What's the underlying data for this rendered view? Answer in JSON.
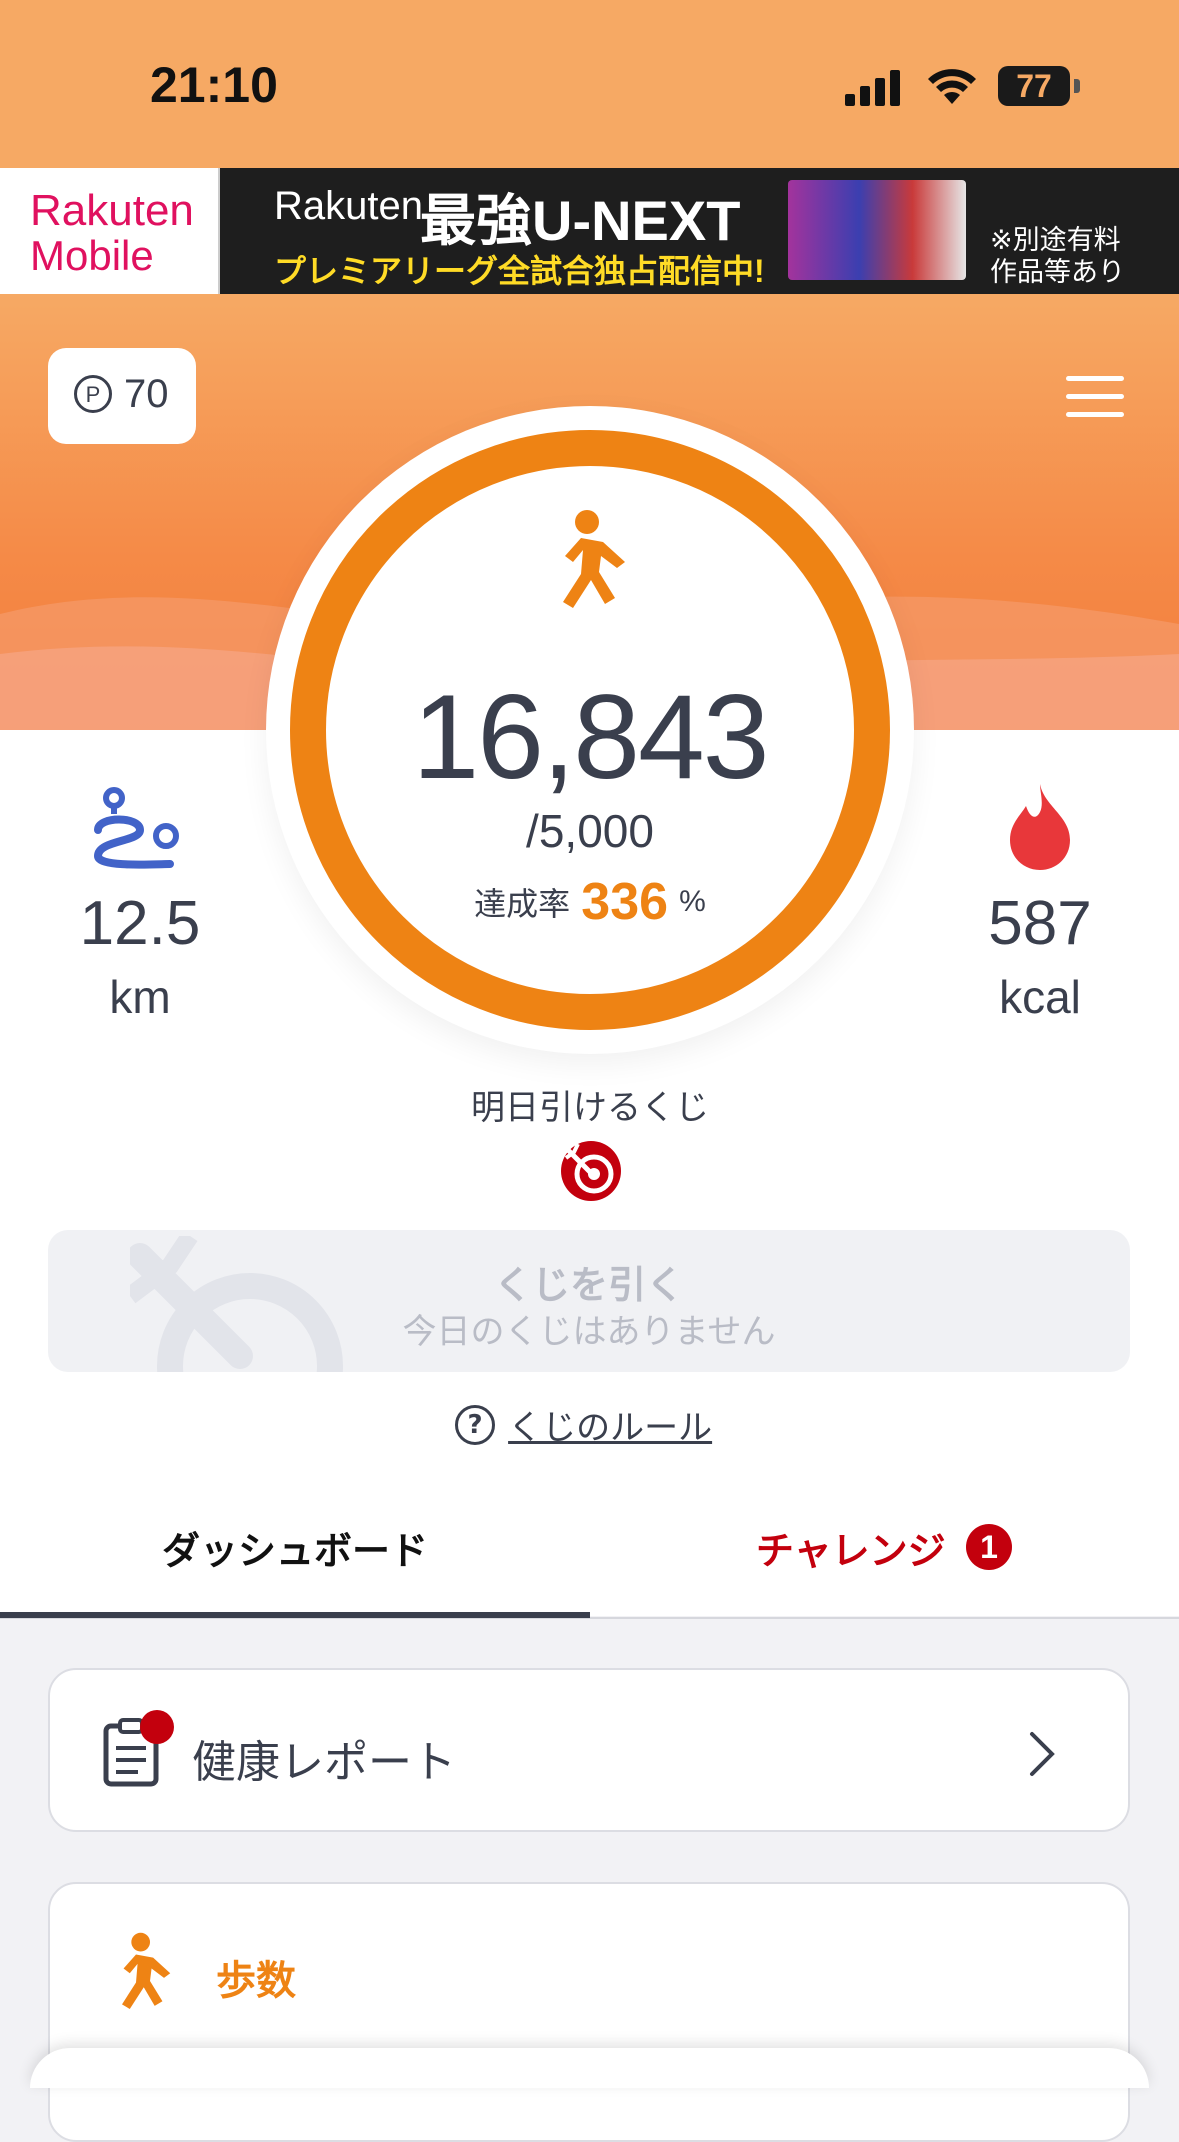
{
  "status_bar": {
    "time": "21:10",
    "battery": "77"
  },
  "ad": {
    "logo_line1": "Rakuten",
    "logo_line2": "Mobile",
    "brand": "Rakuten",
    "headline": "最強U-NEXT",
    "sub": "プレミアリーグ全試合独占配信中!",
    "note_line1": "※別途有料",
    "note_line2": "作品等あり"
  },
  "header": {
    "points": "70",
    "points_icon": "P"
  },
  "steps": {
    "count": "16,843",
    "goal": "/5,000",
    "rate_label": "達成率",
    "rate_value": "336",
    "rate_unit": "%",
    "rate_fraction": 3.3686
  },
  "distance": {
    "value": "12.5",
    "unit": "km"
  },
  "calories": {
    "value": "587",
    "unit": "kcal"
  },
  "lottery": {
    "title": "明日引けるくじ",
    "button_title": "くじを引く",
    "button_sub": "今日のくじはありません",
    "rules_icon": "?",
    "rules_link": "くじのルール"
  },
  "tabs": {
    "dashboard": "ダッシュボード",
    "challenge": "チャレンジ",
    "challenge_badge": "1"
  },
  "cards": {
    "report": "健康レポート",
    "steps": "歩数"
  },
  "colors": {
    "accent": "#ee8314",
    "header_orange": "#f6a964",
    "red": "#c3000d",
    "text": "#3a3f4d",
    "distance_blue": "#4263c8",
    "flame_red": "#e8373a"
  }
}
